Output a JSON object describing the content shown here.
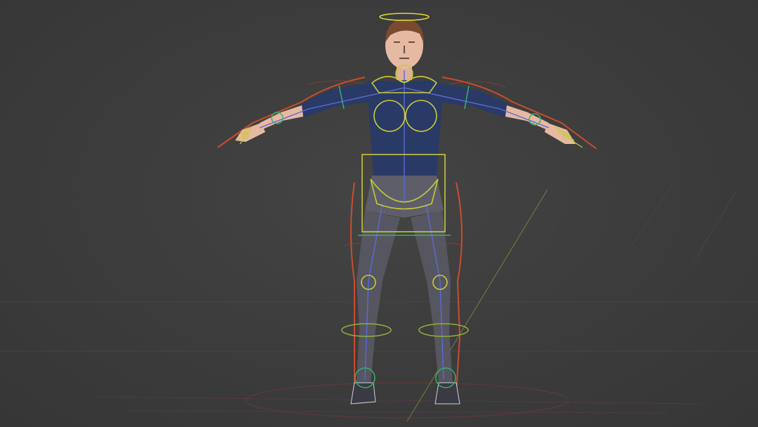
{
  "viewport": {
    "background": "#3a3a3a",
    "grid_line_color": "#4a4a4a",
    "floor_axis_color": "#8a9a3a"
  },
  "character": {
    "skin_color": "#e6b9a3",
    "hair_color": "#7a4a30",
    "shirt_color": "#2a3a66",
    "legs_color": "#5a5a66",
    "shoe_color": "#3a3a44"
  },
  "rig": {
    "fk_control_color": "#c7c93a",
    "ik_control_color": "#3ab06a",
    "deform_outline_color": "#e0502a",
    "root_halo_color": "#d6d63a",
    "bone_color": "#5a6ad8"
  },
  "icons": {
    "halo": "halo-icon"
  }
}
